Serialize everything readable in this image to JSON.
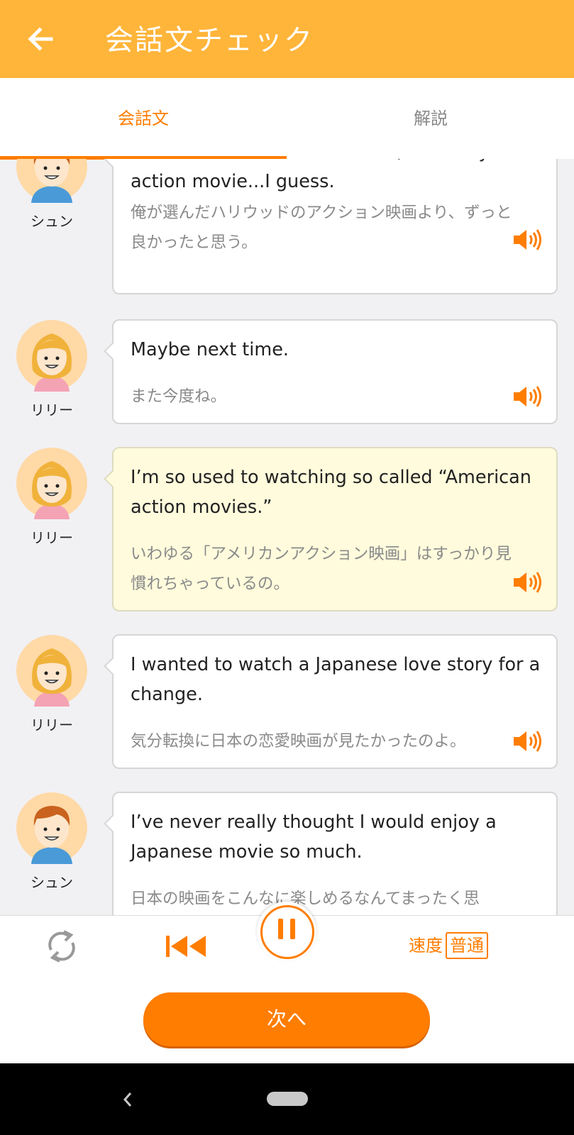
{
  "appbar": {
    "title": "会話文チェック",
    "back_icon": "arrow-left-icon"
  },
  "tabs": [
    {
      "label": "会話文",
      "active": true
    },
    {
      "label": "解説",
      "active": false
    }
  ],
  "colors": {
    "accent": "#ff7d00",
    "header": "#ffb53a",
    "highlight": "#fffbdc"
  },
  "dialogue": [
    {
      "speaker": "シュン",
      "en": "A far better choice than mine, the Hollywood action movie...I guess.",
      "ja": "俺が選んだハリウッドのアクション映画より、ずっと良かったと思う。",
      "highlighted": false
    },
    {
      "speaker": "リリー",
      "en": "Maybe next time.",
      "ja": "また今度ね。",
      "highlighted": false
    },
    {
      "speaker": "リリー",
      "en": "I’m so used to watching so called “American action movies.”",
      "ja": "いわゆる「アメリカンアクション映画」はすっかり見慣れちゃっているの。",
      "highlighted": true
    },
    {
      "speaker": "リリー",
      "en": "I wanted to watch a Japanese love story for a change.",
      "ja": "気分転換に日本の恋愛映画が見たかったのよ。",
      "highlighted": false
    },
    {
      "speaker": "シュン",
      "en": "I’ve never really thought I would enjoy a Japanese movie so much.",
      "ja": "日本の映画をこんなに楽しめるなんてまったく思",
      "highlighted": false
    }
  ],
  "controls": {
    "repeat_icon": "repeat-icon",
    "prev_icon": "skip-back-icon",
    "pause_icon": "pause-icon",
    "speed_label": "速度",
    "speed_value": "普通"
  },
  "next_button": "次へ"
}
